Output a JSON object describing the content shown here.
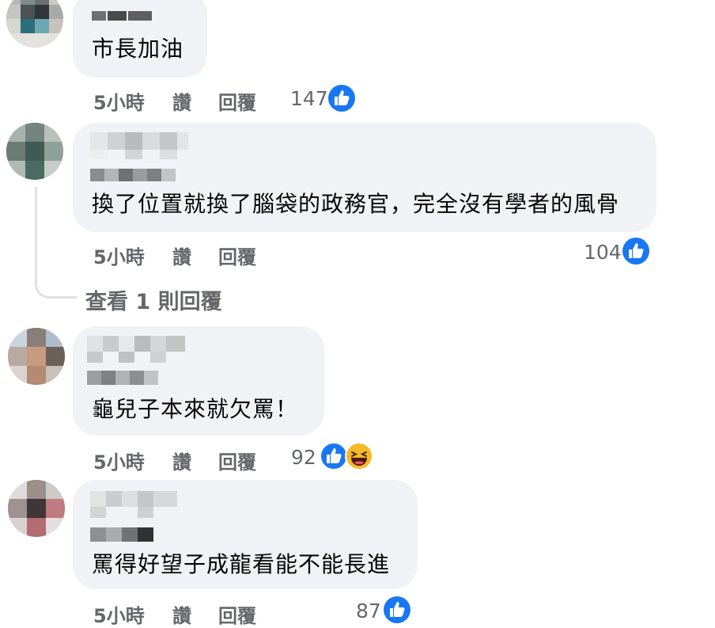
{
  "comments": [
    {
      "text": "市長加油",
      "actions": {
        "time": "5小時",
        "like": "讚",
        "reply": "回覆"
      },
      "reaction_count": "147",
      "reactions": [
        "like-icon"
      ]
    },
    {
      "text": "換了位置就換了腦袋的政務官，完全沒有學者的風骨",
      "actions": {
        "time": "5小時",
        "like": "讚",
        "reply": "回覆"
      },
      "reaction_count": "104",
      "reactions": [
        "like-icon"
      ],
      "view_replies": "查看 1 則回覆"
    },
    {
      "text": "龜兒子本來就欠罵！",
      "actions": {
        "time": "5小時",
        "like": "讚",
        "reply": "回覆"
      },
      "reaction_count": "92",
      "reactions": [
        "like-icon",
        "haha-icon"
      ]
    },
    {
      "text": "罵得好望子成龍看能不能長進",
      "actions": {
        "time": "5小時",
        "like": "讚",
        "reply": "回覆"
      },
      "reaction_count": "87",
      "reactions": [
        "like-icon"
      ]
    }
  ],
  "colors": {
    "bubble": "#f0f2f5",
    "meta_text": "#65676b",
    "like_blue": "#1877f2",
    "haha_yellow": "#f7b928"
  }
}
